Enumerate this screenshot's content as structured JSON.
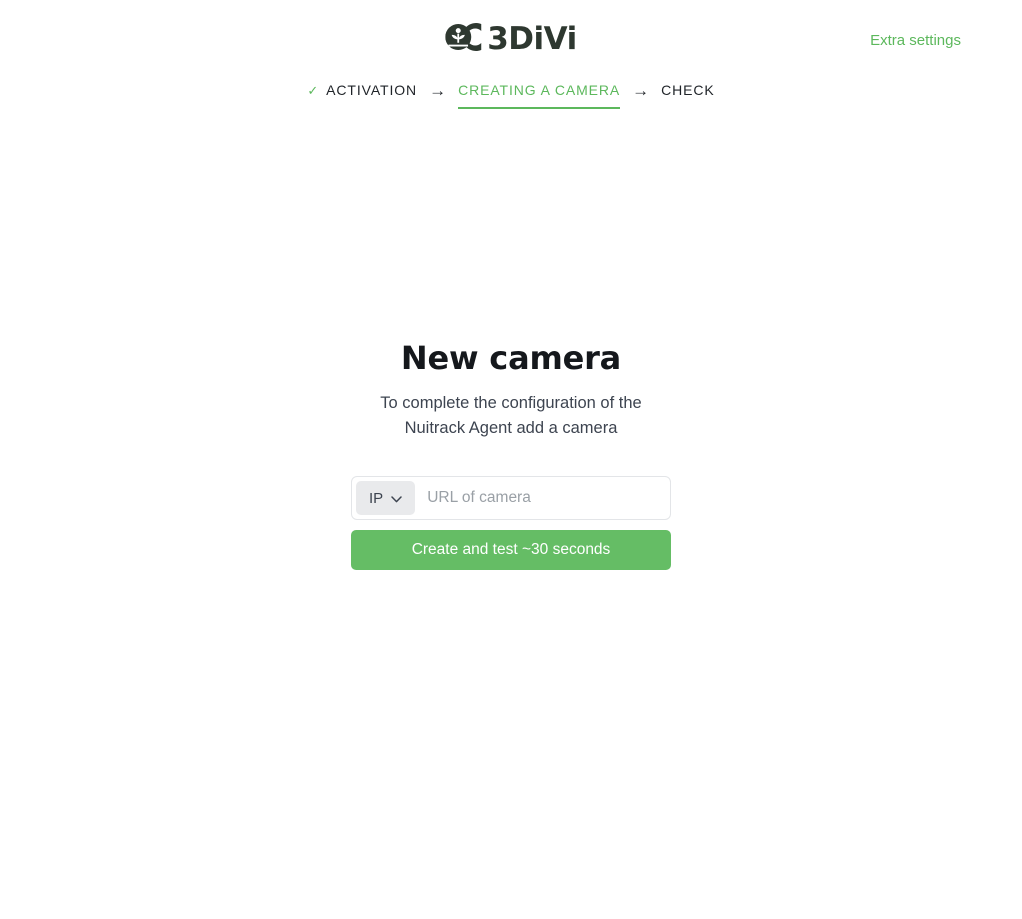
{
  "brand": {
    "name": "3DiVi",
    "mark_icon": "3divi-logo-icon"
  },
  "header": {
    "extra_settings_label": "Extra settings"
  },
  "steps": [
    {
      "label": "ACTIVATION",
      "state": "done",
      "check_icon": "✓"
    },
    {
      "label": "CREATING A CAMERA",
      "state": "active"
    },
    {
      "label": "CHECK",
      "state": "upcoming"
    }
  ],
  "step_separator": "→",
  "main": {
    "title": "New camera",
    "subtitle": "To complete the configuration of the Nuitrack Agent add a camera"
  },
  "form": {
    "protocol": {
      "value": "IP",
      "chevron_icon": "chevron-down-icon"
    },
    "url": {
      "value": "",
      "placeholder": "URL of camera"
    },
    "submit_label": "Create and test ~30 seconds"
  },
  "colors": {
    "accent_green": "#5cb85c",
    "button_green": "#65bd65",
    "text_dark": "#1f2328",
    "logo_dark": "#2e3830"
  }
}
